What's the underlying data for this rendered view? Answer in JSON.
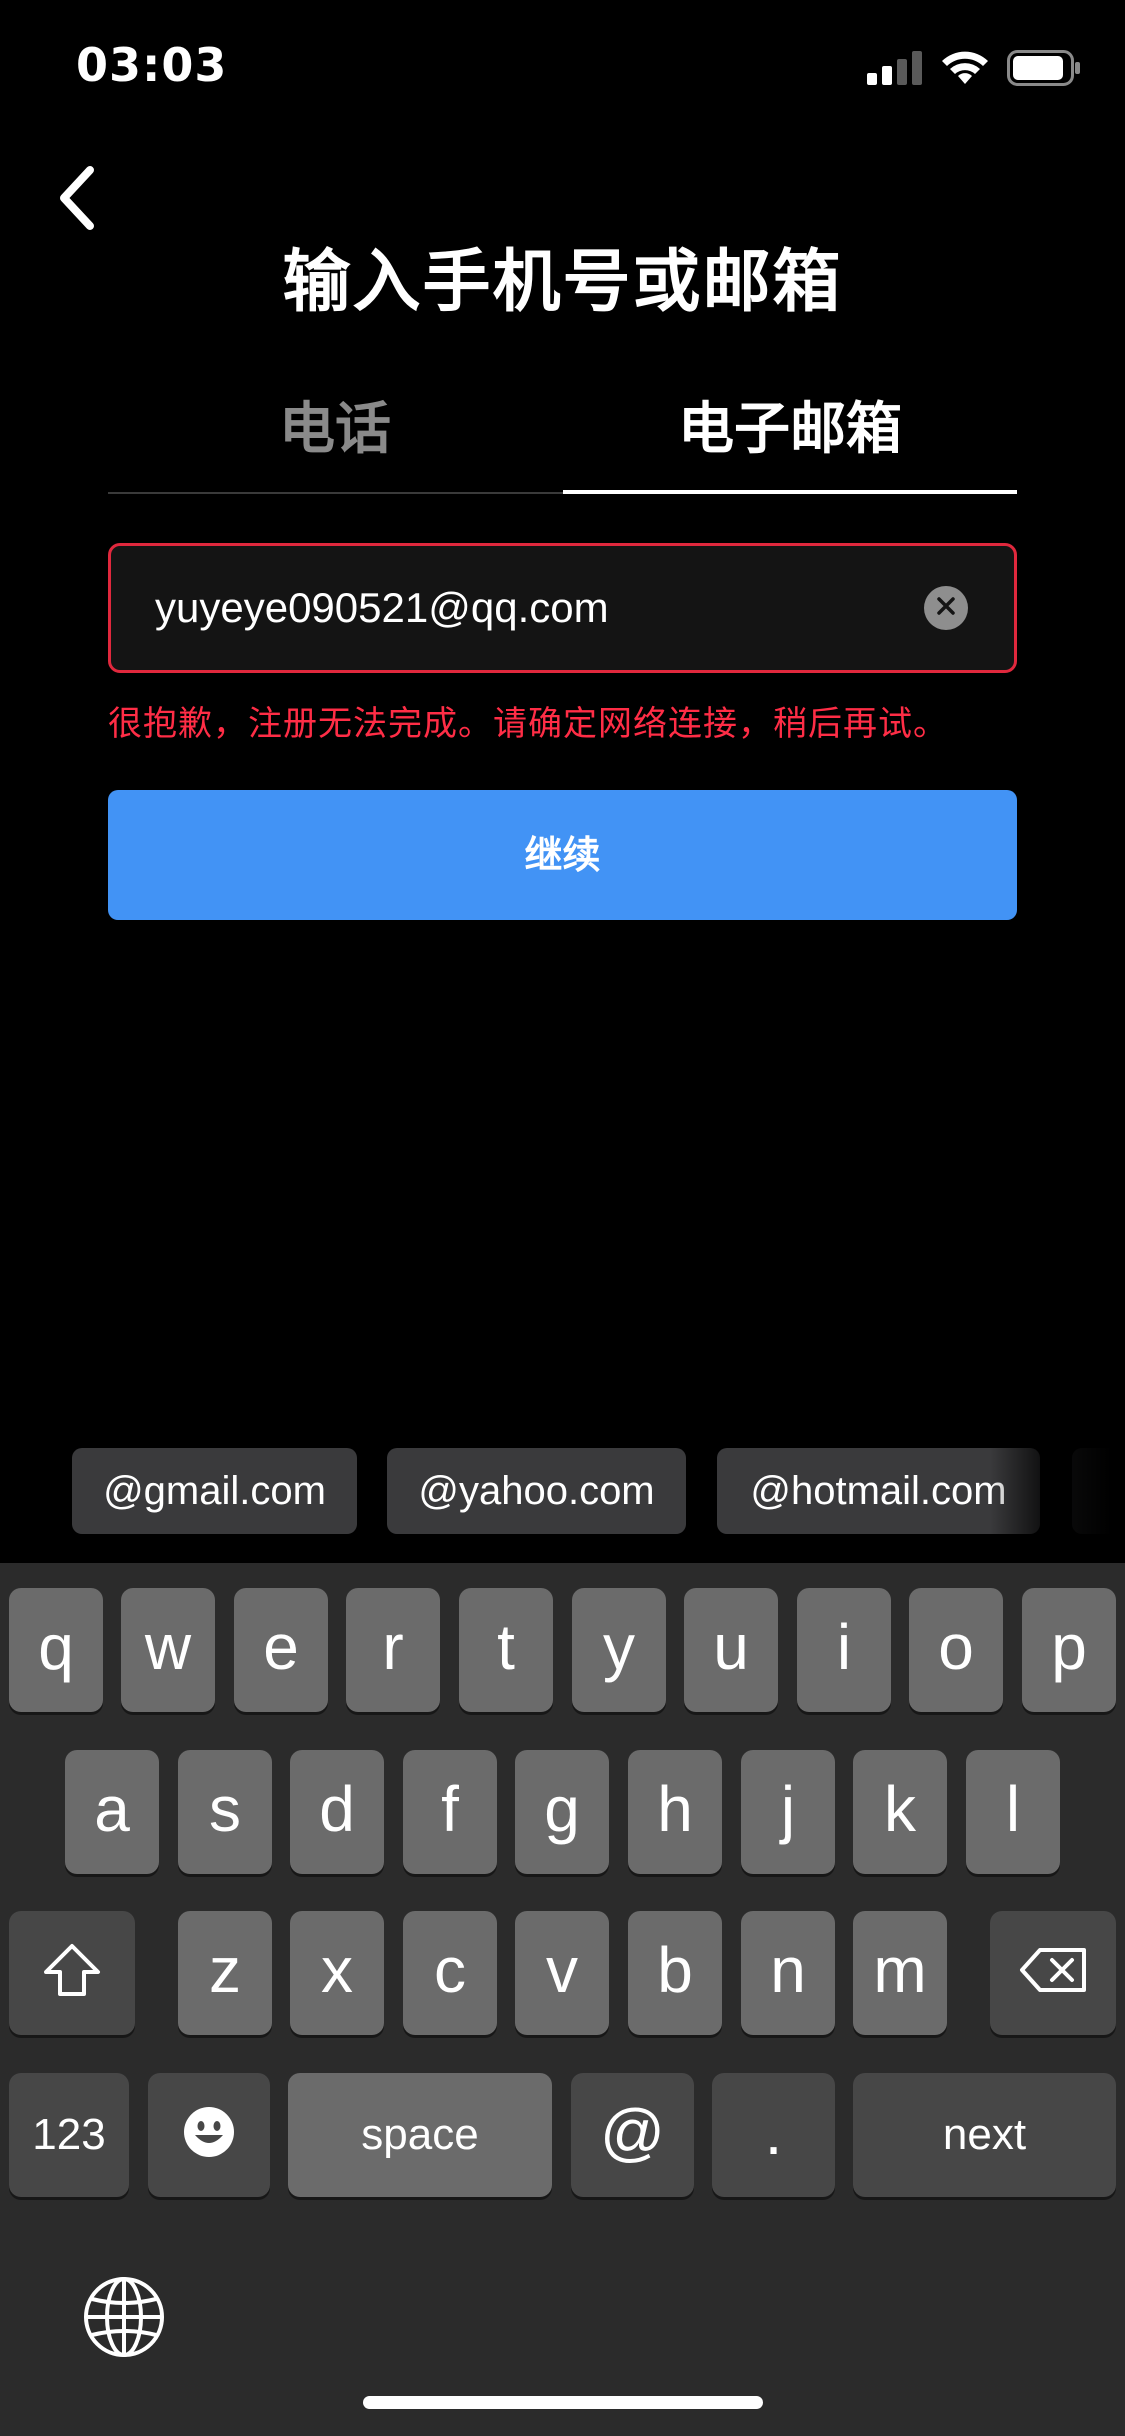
{
  "status_bar": {
    "time": "03:03"
  },
  "header": {
    "title": "输入手机号或邮箱"
  },
  "tabs": [
    {
      "label": "电话",
      "active": false
    },
    {
      "label": "电子邮箱",
      "active": true
    }
  ],
  "email_input": {
    "value": "yuyeye090521@qq.com"
  },
  "error_message": "很抱歉，注册无法完成。请确定网络连接，稍后再试。",
  "continue_label": "继续",
  "suggestions": [
    "@gmail.com",
    "@yahoo.com",
    "@hotmail.com"
  ],
  "keyboard": {
    "row1": [
      "q",
      "w",
      "e",
      "r",
      "t",
      "y",
      "u",
      "i",
      "o",
      "p"
    ],
    "row2": [
      "a",
      "s",
      "d",
      "f",
      "g",
      "h",
      "j",
      "k",
      "l"
    ],
    "row3": [
      "z",
      "x",
      "c",
      "v",
      "b",
      "n",
      "m"
    ],
    "numbers_label": "123",
    "space_label": "space",
    "at_label": "@",
    "dot_label": ".",
    "next_label": "next"
  },
  "colors": {
    "accent": "#4293f5",
    "error": "#ff2d46",
    "error_border": "#e0283d"
  }
}
